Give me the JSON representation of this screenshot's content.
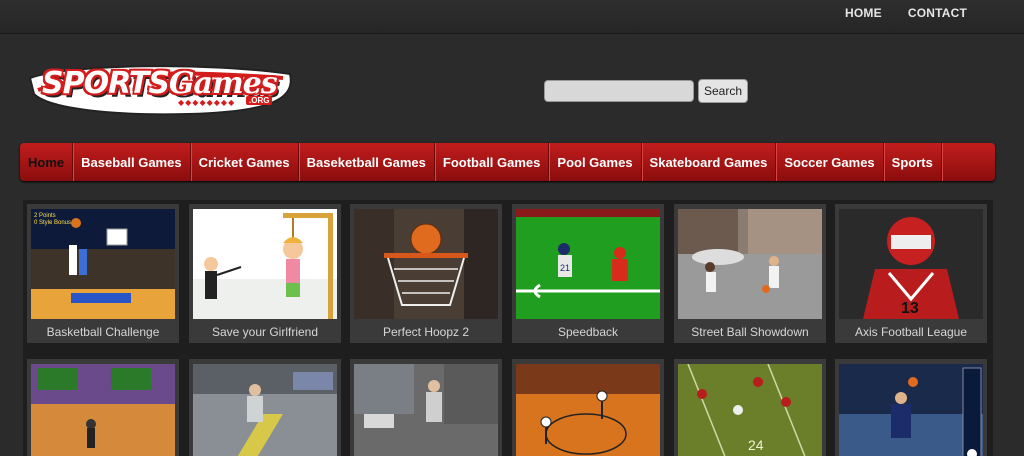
{
  "topnav": {
    "home": "HOME",
    "contact": "CONTACT"
  },
  "logo": {
    "main": "SPORTS",
    "script": "Games",
    "suffix": ".ORG"
  },
  "search": {
    "placeholder": "",
    "button": "Search"
  },
  "categories": [
    "Home",
    "Baseball Games",
    "Cricket Games",
    "Baseketball Games",
    "Football Games",
    "Pool Games",
    "Skateboard Games",
    "Soccer Games",
    "Sports"
  ],
  "games_row1": [
    "Basketball Challenge",
    "Save your Girlfriend",
    "Perfect Hoopz 2",
    "Speedback",
    "Street Ball Showdown",
    "Axis Football League"
  ],
  "thumb_text": {
    "bb_challenge": "2 Points\n0 Style Bonus",
    "axis_number": "13",
    "soccer_jersey": "24"
  }
}
